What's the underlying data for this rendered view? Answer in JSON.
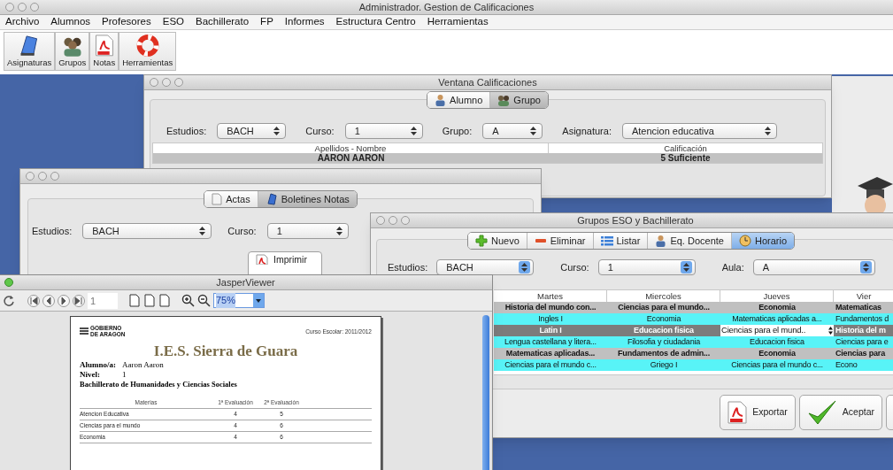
{
  "main_window": {
    "title": "Administrador. Gestion de Calificaciones",
    "menu": [
      "Archivo",
      "Alumnos",
      "Profesores",
      "ESO",
      "Bachillerato",
      "FP",
      "Informes",
      "Estructura Centro",
      "Herramientas"
    ],
    "toolbar": [
      {
        "label": "Asignaturas",
        "kind": "book"
      },
      {
        "label": "Grupos",
        "kind": "people"
      },
      {
        "label": "Notas",
        "kind": "pdf"
      },
      {
        "label": "Herramientas",
        "kind": "lifebuoy"
      }
    ]
  },
  "calificaciones_window": {
    "title": "Ventana Calificaciones",
    "tabs": [
      {
        "label": "Alumno",
        "selected": false,
        "kind": "person"
      },
      {
        "label": "Grupo",
        "selected": true,
        "kind": "people"
      }
    ],
    "filters": [
      {
        "label": "Estudios:",
        "value": "BACH"
      },
      {
        "label": "Curso:",
        "value": "1"
      },
      {
        "label": "Grupo:",
        "value": "A"
      },
      {
        "label": "Asignatura:",
        "value": "Atencion educativa"
      }
    ],
    "table": {
      "columns": [
        "Apellidos - Nombre",
        "Calificación"
      ],
      "rows": [
        {
          "selected": true,
          "cells": [
            "AARON AARON",
            "5 Suficiente"
          ]
        }
      ]
    }
  },
  "actas_window": {
    "tabs": [
      {
        "label": "Actas",
        "selected": false,
        "kind": "document"
      },
      {
        "label": "Boletines Notas",
        "selected": true,
        "kind": "book"
      }
    ],
    "filters": [
      {
        "label": "Estudios:",
        "value": "BACH"
      },
      {
        "label": "Curso:",
        "value": "1"
      }
    ],
    "button": {
      "label": "Imprimir"
    }
  },
  "grupos_window": {
    "title": "Grupos ESO y Bachillerato",
    "toolbar": [
      {
        "label": "Nuevo",
        "selected": false,
        "kind": "plus"
      },
      {
        "label": "Eliminar",
        "selected": false,
        "kind": "minus"
      },
      {
        "label": "Listar",
        "selected": false,
        "kind": "list"
      },
      {
        "label": "Eq. Docente",
        "selected": false,
        "kind": "person"
      },
      {
        "label": "Horario",
        "selected": true,
        "kind": "clock"
      }
    ],
    "filters": [
      {
        "label": "Estudios:",
        "value": "BACH"
      },
      {
        "label": "Curso:",
        "value": "1"
      },
      {
        "label": "Aula:",
        "value": "A"
      }
    ],
    "schedule": {
      "columns": [
        "Martes",
        "Miercoles",
        "Jueves",
        "Vier"
      ],
      "rows": [
        {
          "selected": false,
          "cells": [
            {
              "text": "Historia del mundo con...",
              "editing": false
            },
            {
              "text": "Ciencias para el mundo...",
              "editing": false
            },
            {
              "text": "Economia",
              "editing": false
            },
            {
              "text": "Matematicas",
              "editing": false
            }
          ]
        },
        {
          "selected": false,
          "cells": [
            {
              "text": "Ingles I",
              "editing": false
            },
            {
              "text": "Economia",
              "editing": false
            },
            {
              "text": "Matematicas aplicadas a...",
              "editing": false
            },
            {
              "text": "Fundamentos d",
              "editing": false
            }
          ]
        },
        {
          "selected": true,
          "cells": [
            {
              "text": "Latin I",
              "editing": false
            },
            {
              "text": "Educacion fisica",
              "editing": false
            },
            {
              "text": "Ciencias para el mund..",
              "editing": true
            },
            {
              "text": "Historia del m",
              "editing": false
            }
          ]
        },
        {
          "selected": false,
          "cells": [
            {
              "text": "Lengua castellana y litera...",
              "editing": false
            },
            {
              "text": "Filosofia y ciudadania",
              "editing": false
            },
            {
              "text": "Educacion fisica",
              "editing": false
            },
            {
              "text": "Ciencias para e",
              "editing": false
            }
          ]
        },
        {
          "selected": false,
          "cells": [
            {
              "text": "Matematicas aplicadas...",
              "editing": false
            },
            {
              "text": "Fundamentos de admin...",
              "editing": false
            },
            {
              "text": "Economia",
              "editing": false
            },
            {
              "text": "Ciencias para",
              "editing": false
            }
          ]
        },
        {
          "selected": false,
          "cells": [
            {
              "text": "Ciencias para el mundo c...",
              "editing": false
            },
            {
              "text": "Griego I",
              "editing": false
            },
            {
              "text": "Ciencias para el mundo c...",
              "editing": false
            },
            {
              "text": "Econo",
              "editing": false
            }
          ]
        }
      ]
    },
    "buttons": [
      {
        "label": "Exportar",
        "kind": "pdf"
      },
      {
        "label": "Aceptar",
        "kind": "accept"
      },
      {
        "kind": "cancel"
      }
    ]
  },
  "jasper_viewer": {
    "title": "JasperViewer",
    "page_number": "1",
    "zoom": "75%",
    "report": {
      "logo": [
        "GOBIERNO",
        "DE ARAGON"
      ],
      "school_year": "Curso Escolar: 2011/2012",
      "school": "I.E.S. Sierra de Guara",
      "fields": [
        {
          "label": "Alumno/a:",
          "value": "Aaron Aaron"
        },
        {
          "label": "Nivel:",
          "value": "1"
        }
      ],
      "program": "Bachillerato de Humanidades y Ciencias Sociales",
      "grades": {
        "columns": [
          "Materias",
          "1ª Evaluación",
          "2ª Evaluación"
        ],
        "rows": [
          [
            "Atencion Educativa",
            "4",
            "5"
          ],
          [
            "Ciencias para el mundo",
            "4",
            "6"
          ],
          [
            "Economia",
            "4",
            "6"
          ]
        ]
      }
    }
  }
}
